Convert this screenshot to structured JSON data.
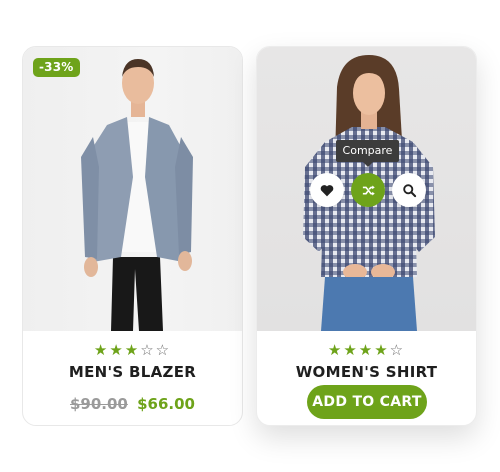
{
  "products": [
    {
      "name": "MEN'S BLAZER",
      "badge": "-33%",
      "rating_stars": 3,
      "rating_max": 5,
      "old_price": "$90.00",
      "price": "$66.00",
      "image_icon": "product-photo-mens-blazer"
    },
    {
      "name": "WOMEN'S SHIRT",
      "rating_stars": 4,
      "rating_max": 5,
      "image_icon": "product-photo-womens-shirt",
      "tooltip": "Compare",
      "action_icons": [
        "heart-icon",
        "shuffle-compare-icon",
        "search-icon"
      ],
      "cta_label": "ADD TO CART"
    }
  ],
  "colors": {
    "accent": "#6ea31a",
    "tooltip_bg": "#3c3c3c",
    "old_price": "#9a9a9a"
  }
}
